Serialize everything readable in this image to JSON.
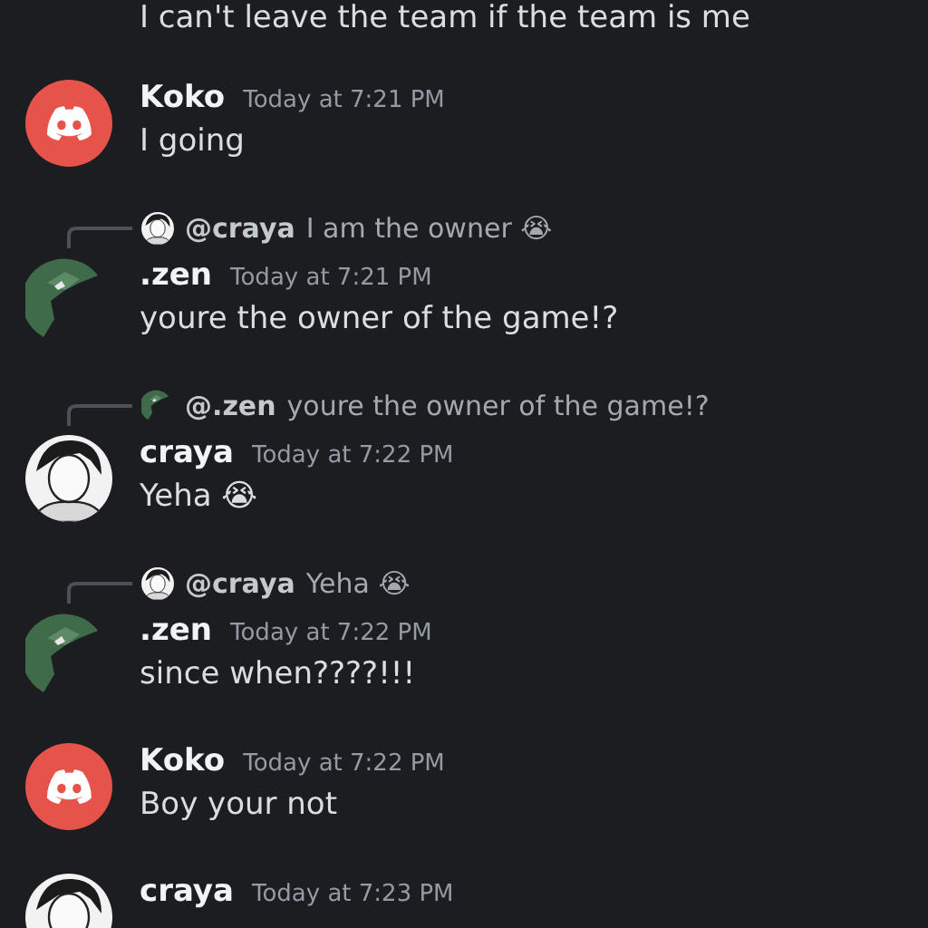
{
  "messages": [
    {
      "kind": "continuation",
      "text": "I can't leave the team if the team is me"
    },
    {
      "kind": "message",
      "author": "Koko",
      "avatar": {
        "kind": "logo"
      },
      "time": "Today at 7:21 PM",
      "text": "I going"
    },
    {
      "kind": "message",
      "reply": {
        "author": "@craya",
        "avatar": {
          "kind": "figure"
        },
        "text": "I am the owner 😭"
      },
      "author": ".zen",
      "avatar": {
        "kind": "green"
      },
      "time": "Today at 7:21 PM",
      "text": "youre the owner of the game!?"
    },
    {
      "kind": "message",
      "reply": {
        "author": "@.zen",
        "avatar": {
          "kind": "green"
        },
        "text": "youre the owner of the game!?"
      },
      "author": "craya",
      "avatar": {
        "kind": "figure"
      },
      "time": "Today at 7:22 PM",
      "text": "Yeha 😭"
    },
    {
      "kind": "message",
      "reply": {
        "author": "@craya",
        "avatar": {
          "kind": "figure"
        },
        "text": "Yeha 😭"
      },
      "author": ".zen",
      "avatar": {
        "kind": "green"
      },
      "time": "Today at 7:22 PM",
      "text": "since when????!!!"
    },
    {
      "kind": "message",
      "author": "Koko",
      "avatar": {
        "kind": "logo"
      },
      "time": "Today at 7:22 PM",
      "text": "Boy your not"
    },
    {
      "kind": "message",
      "author": "craya",
      "avatar": {
        "kind": "figure"
      },
      "time": "Today at 7:23 PM"
    }
  ]
}
